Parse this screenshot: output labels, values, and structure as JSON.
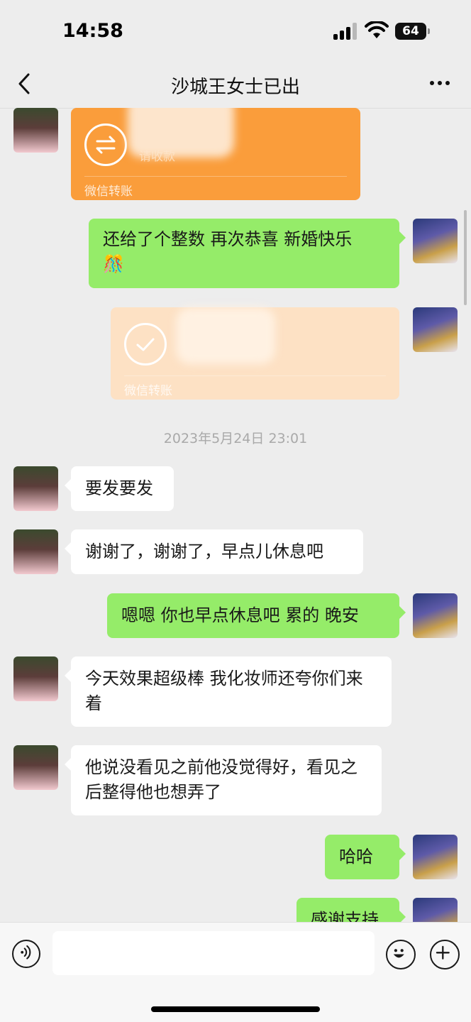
{
  "status_bar": {
    "time": "14:58",
    "battery": "64"
  },
  "nav": {
    "title": "沙城王女士已出"
  },
  "messages": {
    "transfer_1": {
      "subtext": "请收款",
      "label": "微信转账",
      "color": "#fa9d3b"
    },
    "msg_right_1": "还给了个整数 再次恭喜 新婚快乐",
    "msg_right_1_emoji": "🎊",
    "transfer_2": {
      "label": "微信转账",
      "color": "#fde1c4"
    },
    "timestamp": "2023年5月24日 23:01",
    "msg_left_1": "要发要发",
    "msg_left_2": "谢谢了，谢谢了，早点儿休息吧",
    "msg_right_2": "嗯嗯 你也早点休息吧 累的 晚安",
    "msg_left_3": "今天效果超级棒 我化妆师还夸你们来着",
    "msg_left_4": "他说没看见之前他没觉得好，看见之后整得他也想弄了",
    "msg_right_3": "哈哈",
    "msg_right_4": "感谢支持"
  },
  "colors": {
    "self_bubble": "#95ec69",
    "other_bubble": "#ffffff",
    "background": "#ededed"
  }
}
